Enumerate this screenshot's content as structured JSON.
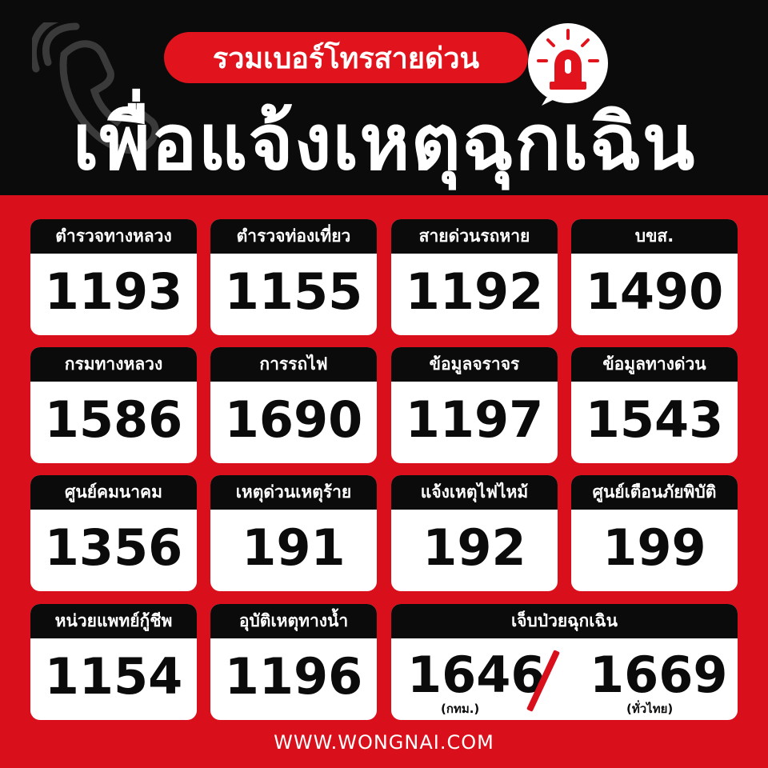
{
  "header": {
    "pill_text": "รวมเบอร์โทรสายด่วน",
    "headline": "เพื่อแจ้งเหตุฉุกเฉิน"
  },
  "cards": [
    {
      "label": "ตำรวจทางหลวง",
      "number": "1193"
    },
    {
      "label": "ตำรวจท่องเที่ยว",
      "number": "1155"
    },
    {
      "label": "สายด่วนรถหาย",
      "number": "1192"
    },
    {
      "label": "บขส.",
      "number": "1490"
    },
    {
      "label": "กรมทางหลวง",
      "number": "1586"
    },
    {
      "label": "การรถไฟ",
      "number": "1690"
    },
    {
      "label": "ข้อมูลจราจร",
      "number": "1197"
    },
    {
      "label": "ข้อมูลทางด่วน",
      "number": "1543"
    },
    {
      "label": "ศูนย์คมนาคม",
      "number": "1356"
    },
    {
      "label": "เหตุด่วนเหตุร้าย",
      "number": "191"
    },
    {
      "label": "แจ้งเหตุไฟไหม้",
      "number": "192"
    },
    {
      "label": "ศูนย์เตือนภัยพิบัติ",
      "number": "199"
    },
    {
      "label": "หน่วยแพทย์กู้ชีพ",
      "number": "1154"
    },
    {
      "label": "อุบัติเหตุทางน้ำ",
      "number": "1196"
    }
  ],
  "emergency_card": {
    "label": "เจ็บป่วยฉุกเฉิน",
    "number_bkk": "1646",
    "note_bkk": "(กทม.)",
    "number_nationwide": "1669",
    "note_nationwide": "(ทั่วไทย)"
  },
  "footer": {
    "text": "WWW.WONGNAI.COM"
  },
  "colors": {
    "red": "#d9101b",
    "black": "#0b0b0b",
    "white": "#ffffff"
  },
  "icons": {
    "phone": "phone-icon",
    "siren": "siren-icon"
  }
}
